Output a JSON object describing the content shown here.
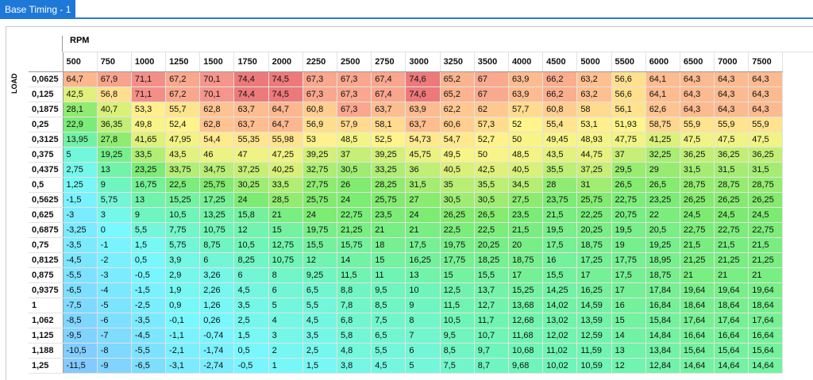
{
  "window": {
    "tab_title": "Base Timing - 1"
  },
  "table": {
    "x_axis_title": "RPM",
    "y_axis_title": "LOAD",
    "columns": [
      "500",
      "750",
      "1000",
      "1250",
      "1500",
      "1750",
      "2000",
      "2250",
      "2500",
      "2750",
      "3000",
      "3250",
      "3500",
      "4000",
      "4500",
      "5000",
      "5500",
      "6000",
      "6500",
      "7000",
      "7500"
    ],
    "rows": [
      {
        "load": "0,0625",
        "values": [
          "64,7",
          "67,9",
          "71,1",
          "67,2",
          "70,1",
          "74,4",
          "74,5",
          "67,3",
          "67,3",
          "67,4",
          "74,6",
          "65,2",
          "67",
          "63,9",
          "66,2",
          "63,2",
          "56,6",
          "64,1",
          "64,3",
          "64,3",
          "64,3"
        ]
      },
      {
        "load": "0,125",
        "values": [
          "42,5",
          "56,8",
          "71,1",
          "67,2",
          "70,1",
          "74,4",
          "74,5",
          "67,3",
          "67,3",
          "67,4",
          "74,6",
          "65,2",
          "67",
          "63,9",
          "66,2",
          "63,2",
          "56,6",
          "64,1",
          "64,3",
          "64,3",
          "64,3"
        ]
      },
      {
        "load": "0,1875",
        "values": [
          "28,1",
          "40,7",
          "53,3",
          "55,7",
          "62,8",
          "63,7",
          "64,7",
          "60,8",
          "67,3",
          "63,7",
          "63,9",
          "62,2",
          "62",
          "57,7",
          "60,8",
          "58",
          "56,1",
          "62,6",
          "64,3",
          "64,3",
          "64,3"
        ]
      },
      {
        "load": "0,25",
        "values": [
          "22,9",
          "36,35",
          "49,8",
          "52,4",
          "62,8",
          "63,7",
          "64,7",
          "56,9",
          "57,9",
          "58,1",
          "63,7",
          "60,6",
          "57,3",
          "52",
          "55,4",
          "53,1",
          "51,93",
          "58,75",
          "55,9",
          "55,9",
          "55,9"
        ]
      },
      {
        "load": "0,3125",
        "values": [
          "13,95",
          "27,8",
          "41,65",
          "47,95",
          "54,4",
          "55,35",
          "55,98",
          "53",
          "48,5",
          "52,5",
          "54,73",
          "54,7",
          "52,7",
          "50",
          "49,45",
          "48,93",
          "47,75",
          "41,25",
          "47,5",
          "47,5",
          "47,5"
        ]
      },
      {
        "load": "0,375",
        "values": [
          "5",
          "19,25",
          "33,5",
          "43,5",
          "46",
          "47",
          "47,25",
          "39,25",
          "37",
          "39,25",
          "45,75",
          "49,5",
          "50",
          "48,5",
          "43,5",
          "44,75",
          "37",
          "32,25",
          "36,25",
          "36,25",
          "36,25"
        ]
      },
      {
        "load": "0,4375",
        "values": [
          "2,75",
          "13",
          "23,25",
          "33,75",
          "34,75",
          "37,25",
          "40,25",
          "32,75",
          "30,5",
          "33,25",
          "36",
          "40,5",
          "42,5",
          "40,5",
          "35,5",
          "37,25",
          "29,5",
          "29",
          "31,5",
          "31,5",
          "31,5"
        ]
      },
      {
        "load": "0,5",
        "values": [
          "1,25",
          "9",
          "16,75",
          "22,5",
          "25,75",
          "30,25",
          "33,5",
          "27,75",
          "26",
          "28,25",
          "31,5",
          "35",
          "35,5",
          "34,5",
          "28",
          "31",
          "26,5",
          "26,5",
          "28,75",
          "28,75",
          "28,75"
        ]
      },
      {
        "load": "0,5625",
        "values": [
          "-1,5",
          "5,75",
          "13",
          "15,25",
          "17,25",
          "24",
          "28,5",
          "25,75",
          "24",
          "25,75",
          "27",
          "30,5",
          "30,5",
          "27,5",
          "23,75",
          "25,75",
          "22,75",
          "23,25",
          "26,25",
          "26,25",
          "26,25"
        ]
      },
      {
        "load": "0,625",
        "values": [
          "-3",
          "3",
          "9",
          "10,5",
          "13,25",
          "15,8",
          "21",
          "24",
          "22,75",
          "23,5",
          "24",
          "26,25",
          "26,5",
          "23,5",
          "21,5",
          "22,25",
          "20,75",
          "22",
          "24,5",
          "24,5",
          "24,5"
        ]
      },
      {
        "load": "0,6875",
        "values": [
          "-3,25",
          "0",
          "5,5",
          "7,75",
          "10,75",
          "12",
          "15",
          "19,75",
          "21,25",
          "21",
          "21",
          "22,5",
          "22,5",
          "21,5",
          "19,5",
          "20,25",
          "19,5",
          "20,5",
          "22,75",
          "22,75",
          "22,75"
        ]
      },
      {
        "load": "0,75",
        "values": [
          "-3,5",
          "-1",
          "1,5",
          "5,75",
          "8,75",
          "10,5",
          "12,75",
          "15,5",
          "15,75",
          "18",
          "17,5",
          "19,75",
          "20,25",
          "20",
          "17,5",
          "18,75",
          "19",
          "19,25",
          "21,5",
          "21,5",
          "21,5"
        ]
      },
      {
        "load": "0,8125",
        "values": [
          "-4,5",
          "-2",
          "0,5",
          "3,9",
          "6",
          "8,25",
          "10,75",
          "12",
          "14",
          "15",
          "16,25",
          "17,75",
          "18,25",
          "18,75",
          "16",
          "17,25",
          "17,75",
          "18,95",
          "21,25",
          "21,25",
          "21,25"
        ]
      },
      {
        "load": "0,875",
        "values": [
          "-5,5",
          "-3",
          "-0,5",
          "2,9",
          "3,26",
          "6",
          "8",
          "9,25",
          "11,5",
          "11",
          "13",
          "15",
          "15,5",
          "17",
          "15,5",
          "17",
          "17,5",
          "18,75",
          "21",
          "21",
          "21"
        ]
      },
      {
        "load": "0,9375",
        "values": [
          "-6,5",
          "-4",
          "-1,5",
          "1,9",
          "2,26",
          "4,5",
          "6",
          "6,5",
          "8,8",
          "9,5",
          "10",
          "12,5",
          "13,7",
          "15,25",
          "14,25",
          "16,25",
          "17",
          "17,84",
          "19,64",
          "19,64",
          "19,64"
        ]
      },
      {
        "load": "1",
        "values": [
          "-7,5",
          "-5",
          "-2,5",
          "0,9",
          "1,26",
          "3,5",
          "5",
          "5,5",
          "7,8",
          "8,5",
          "9",
          "11,5",
          "12,7",
          "13,68",
          "14,02",
          "14,59",
          "16",
          "16,84",
          "18,64",
          "18,64",
          "18,64"
        ]
      },
      {
        "load": "1,062",
        "values": [
          "-8,5",
          "-6",
          "-3,5",
          "-0,1",
          "0,26",
          "2,5",
          "4",
          "4,5",
          "6,8",
          "7,5",
          "8",
          "10,5",
          "11,7",
          "12,68",
          "13,02",
          "13,59",
          "15",
          "15,84",
          "17,64",
          "17,64",
          "17,64"
        ]
      },
      {
        "load": "1,125",
        "values": [
          "-9,5",
          "-7",
          "-4,5",
          "-1,1",
          "-0,74",
          "1,5",
          "3",
          "3,5",
          "5,8",
          "6,5",
          "7",
          "9,5",
          "10,7",
          "11,68",
          "12,02",
          "12,59",
          "14",
          "14,84",
          "16,64",
          "16,64",
          "16,64"
        ]
      },
      {
        "load": "1,188",
        "values": [
          "-10,5",
          "-8",
          "-5,5",
          "-2,1",
          "-1,74",
          "0,5",
          "2",
          "2,5",
          "4,8",
          "5,5",
          "6",
          "8,5",
          "9,7",
          "10,68",
          "11,02",
          "11,59",
          "13",
          "13,84",
          "15,64",
          "15,64",
          "15,64"
        ]
      },
      {
        "load": "1,25",
        "values": [
          "-11,5",
          "-9",
          "-6,5",
          "-3,1",
          "-2,74",
          "-0,5",
          "1",
          "1,5",
          "3,8",
          "4,5",
          "5",
          "7,5",
          "8,7",
          "9,68",
          "10,02",
          "10,59",
          "12",
          "12,84",
          "14,64",
          "14,64",
          "14,64"
        ]
      }
    ]
  }
}
